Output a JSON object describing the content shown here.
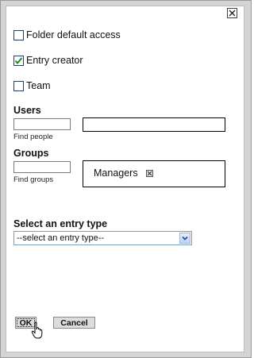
{
  "dialog": {
    "checkboxes": [
      {
        "label": "Folder default access",
        "checked": false
      },
      {
        "label": "Entry creator",
        "checked": true
      },
      {
        "label": "Team",
        "checked": false
      }
    ],
    "users": {
      "title": "Users",
      "find_hint": "Find people",
      "search_value": ""
    },
    "groups": {
      "title": "Groups",
      "find_hint": "Find groups",
      "search_value": "",
      "selected": [
        "Managers"
      ]
    },
    "entry_type": {
      "title": "Select an entry type",
      "selected_option": "--select an entry type--"
    },
    "buttons": {
      "ok": "OK",
      "cancel": "Cancel"
    }
  },
  "icons": {
    "close": "close-icon",
    "check": "check-icon",
    "remove": "remove-icon",
    "dropdown": "chevron-down-icon",
    "cursor": "hand-pointer-icon"
  },
  "colors": {
    "checkbox_border": "#1e3e6e",
    "check_mark": "#1a8a1a",
    "select_border": "#7f9db9"
  }
}
